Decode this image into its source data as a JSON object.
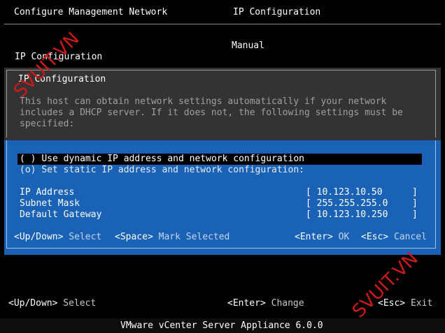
{
  "header": {
    "left_title": "Configure Management Network",
    "right_title": "IP Configuration",
    "mode_value": "Manual",
    "section_label": "IP Configuration"
  },
  "dialog": {
    "title": "IP Configuration",
    "description_lines": [
      "This host can obtain network settings automatically if your network",
      "includes a DHCP server. If it does not, the following settings must be",
      "specified:"
    ],
    "options": [
      {
        "marker": "( )",
        "label": "Use dynamic IP address and network configuration",
        "selected": false,
        "highlighted": true
      },
      {
        "marker": "(o)",
        "label": "Set static IP address and network configuration:",
        "selected": true,
        "highlighted": false
      }
    ],
    "fields": [
      {
        "label": "IP Address",
        "value": "10.123.10.50"
      },
      {
        "label": "Subnet Mask",
        "value": "255.255.255.0"
      },
      {
        "label": "Default Gateway",
        "value": "10.123.10.250"
      }
    ],
    "footer": {
      "nav_key": "<Up/Down>",
      "nav_action": "Select",
      "space_key": "<Space>",
      "space_action": "Mark Selected",
      "enter_key": "<Enter>",
      "enter_action": "OK",
      "esc_key": "<Esc>",
      "esc_action": "Cancel"
    }
  },
  "bottom_hints": {
    "nav_key": "<Up/Down>",
    "nav_action": "Select",
    "enter_key": "<Enter>",
    "enter_action": "Change",
    "esc_key": "<Esc>",
    "esc_action": "Exit"
  },
  "product_bar": "VMware vCenter Server Appliance 6.0.0",
  "watermarks": [
    "SVUIT.VN",
    "SVUIT.VN"
  ],
  "colors": {
    "background": "#000000",
    "dialog_header": "#333333",
    "dialog_body": "#1a62b6",
    "watermark": "#cc1a1a"
  }
}
